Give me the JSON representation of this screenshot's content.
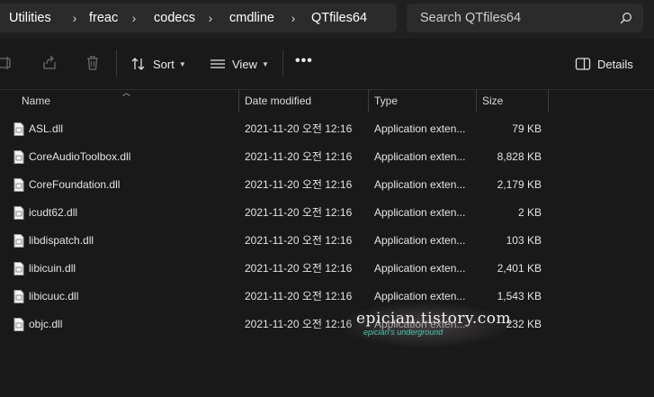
{
  "breadcrumb": [
    "Utilities",
    "freac",
    "codecs",
    "cmdline",
    "QTfiles64"
  ],
  "search": {
    "placeholder": "Search QTfiles64"
  },
  "toolbar": {
    "sort_label": "Sort",
    "view_label": "View",
    "more_label": "•••",
    "details_label": "Details"
  },
  "columns": {
    "name": "Name",
    "date": "Date modified",
    "type": "Type",
    "size": "Size"
  },
  "files": [
    {
      "name": "ASL.dll",
      "date": "2021-11-20 오전 12:16",
      "type": "Application exten...",
      "size": "79 KB"
    },
    {
      "name": "CoreAudioToolbox.dll",
      "date": "2021-11-20 오전 12:16",
      "type": "Application exten...",
      "size": "8,828 KB"
    },
    {
      "name": "CoreFoundation.dll",
      "date": "2021-11-20 오전 12:16",
      "type": "Application exten...",
      "size": "2,179 KB"
    },
    {
      "name": "icudt62.dll",
      "date": "2021-11-20 오전 12:16",
      "type": "Application exten...",
      "size": "2 KB"
    },
    {
      "name": "libdispatch.dll",
      "date": "2021-11-20 오전 12:16",
      "type": "Application exten...",
      "size": "103 KB"
    },
    {
      "name": "libicuin.dll",
      "date": "2021-11-20 오전 12:16",
      "type": "Application exten...",
      "size": "2,401 KB"
    },
    {
      "name": "libicuuc.dll",
      "date": "2021-11-20 오전 12:16",
      "type": "Application exten...",
      "size": "1,543 KB"
    },
    {
      "name": "objc.dll",
      "date": "2021-11-20 오전 12:16",
      "type": "Application exten...",
      "size": "232 KB"
    }
  ],
  "watermark": {
    "main": "epician.tistory.com",
    "sub": "epician's underground"
  }
}
